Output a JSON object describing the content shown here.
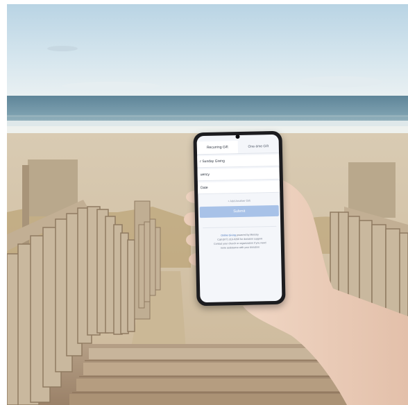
{
  "app": {
    "tabs": [
      "Recurring Gift",
      "One-time Gift"
    ],
    "fields": [
      "r Sunday Giving",
      "uency",
      "Date"
    ],
    "add_label": "+ Add Another Gift",
    "submit_label": "Submit",
    "footer": {
      "line1_brand": "Online Giving",
      "line1_rest": "powered by Ministry",
      "line2": "Call (877) 316-0260 for donation support",
      "line3": "Contact your church or organization if you need",
      "line4": "more assistance with your donation"
    }
  }
}
